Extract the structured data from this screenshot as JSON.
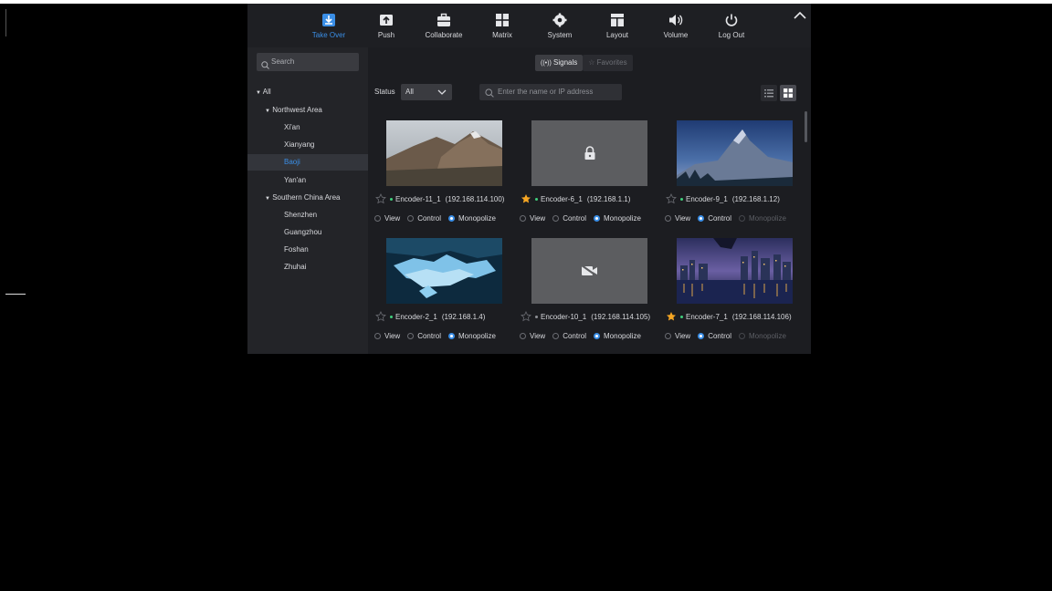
{
  "toolbar": {
    "items": [
      {
        "label": "Take Over",
        "icon": "take-over-icon",
        "active": true
      },
      {
        "label": "Push",
        "icon": "push-icon",
        "active": false
      },
      {
        "label": "Collaborate",
        "icon": "collaborate-icon",
        "active": false
      },
      {
        "label": "Matrix",
        "icon": "matrix-icon",
        "active": false
      },
      {
        "label": "System",
        "icon": "gear-icon",
        "active": false
      },
      {
        "label": "Layout",
        "icon": "layout-icon",
        "active": false
      },
      {
        "label": "Volume",
        "icon": "volume-icon",
        "active": false
      },
      {
        "label": "Log Out",
        "icon": "power-icon",
        "active": false
      }
    ],
    "accent": "#3a8ee6"
  },
  "sidebar": {
    "search_placeholder": "Search",
    "tree": [
      {
        "label": "All",
        "level": 0,
        "expanded": true
      },
      {
        "label": "Northwest Area",
        "level": 1,
        "expanded": true
      },
      {
        "label": "Xi'an",
        "level": 2
      },
      {
        "label": "Xianyang",
        "level": 2
      },
      {
        "label": "Baoji",
        "level": 2,
        "selected": true
      },
      {
        "label": "Yan'an",
        "level": 2
      },
      {
        "label": "Southern China Area",
        "level": 1,
        "expanded": true
      },
      {
        "label": "Shenzhen",
        "level": 2
      },
      {
        "label": "Guangzhou",
        "level": 2
      },
      {
        "label": "Foshan",
        "level": 2
      },
      {
        "label": "Zhuhai",
        "level": 2
      }
    ]
  },
  "tabs": {
    "signals": "Signals",
    "favorites": "Favorites",
    "active": "signals"
  },
  "filters": {
    "status_label": "Status",
    "status_value": "All",
    "search_placeholder": "Enter the name or IP address",
    "view_mode": "grid"
  },
  "options_labels": {
    "view": "View",
    "control": "Control",
    "monopolize": "Monopolize"
  },
  "cards": [
    {
      "name": "Encoder-11_1",
      "ip": "(192.168.114.100)",
      "favorite": false,
      "online": true,
      "thumb": "mountain",
      "selected_option": "monopolize",
      "monopolize_enabled": true
    },
    {
      "name": "Encoder-6_1",
      "ip": "(192.168.1.1)",
      "favorite": true,
      "online": true,
      "thumb": "locked",
      "selected_option": "monopolize",
      "monopolize_enabled": true
    },
    {
      "name": "Encoder-9_1",
      "ip": "(192.168.1.12)",
      "favorite": false,
      "online": true,
      "thumb": "halfdome",
      "selected_option": "control",
      "monopolize_enabled": false
    },
    {
      "name": "Encoder-2_1",
      "ip": "(192.168.1.4)",
      "favorite": false,
      "online": true,
      "thumb": "iceberg",
      "selected_option": "monopolize",
      "monopolize_enabled": true
    },
    {
      "name": "Encoder-10_1",
      "ip": "(192.168.114.105)",
      "favorite": false,
      "online": false,
      "thumb": "nosignal",
      "selected_option": "monopolize",
      "monopolize_enabled": true
    },
    {
      "name": "Encoder-7_1",
      "ip": "(192.168.114.106)",
      "favorite": true,
      "online": true,
      "thumb": "city",
      "selected_option": "control",
      "monopolize_enabled": false
    }
  ]
}
